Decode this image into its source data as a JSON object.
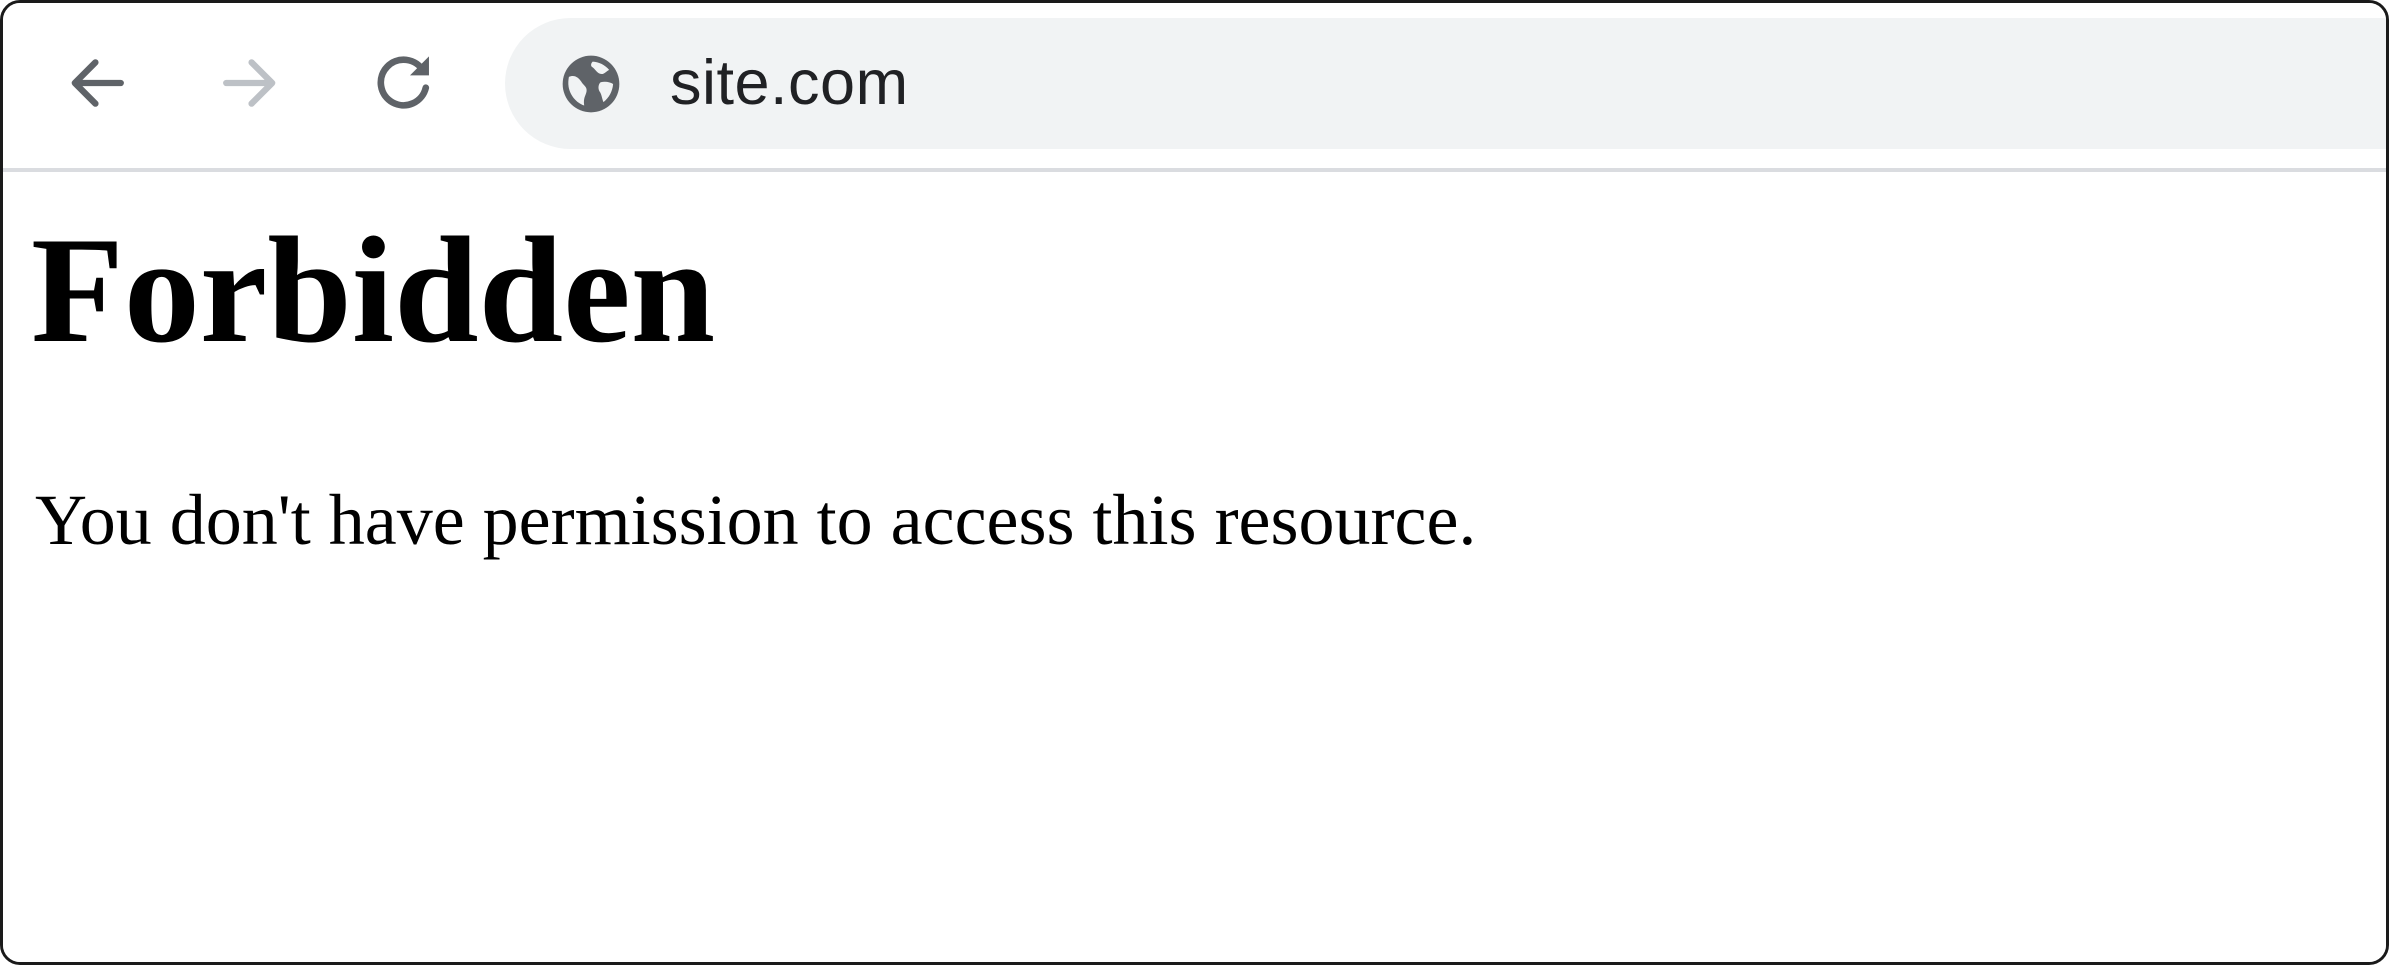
{
  "browser": {
    "toolbar": {
      "back": {
        "icon": "back-arrow-icon",
        "enabled": true
      },
      "forward": {
        "icon": "forward-arrow-icon",
        "enabled": false
      },
      "reload": {
        "icon": "reload-icon"
      }
    },
    "address_bar": {
      "site_icon": "globe-icon",
      "url": "site.com"
    },
    "colors": {
      "icon_active": "#5f6368",
      "icon_disabled": "#bdc1c6",
      "omnibox_bg": "#f1f3f4",
      "divider": "#dadce0"
    }
  },
  "page": {
    "title": "Forbidden",
    "message": "You don't have permission to access this resource."
  }
}
